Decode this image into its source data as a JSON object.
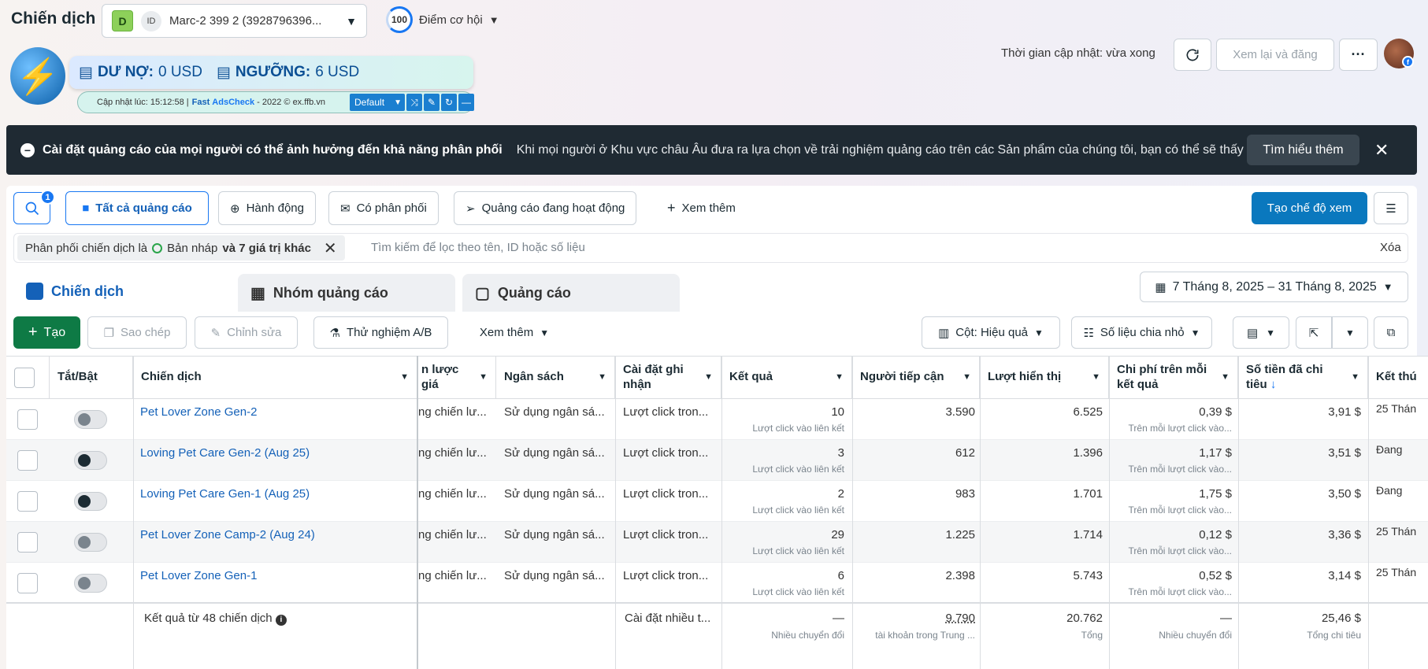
{
  "header": {
    "title": "Chiến dịch",
    "account_badge": "D",
    "account_icon": "ID",
    "account_name": "Marc-2 399 2 (3928796396...",
    "opportunity_score": "100",
    "opportunity_label": "Điểm cơ hội",
    "update_time": "Thời gian cập nhật: vừa xong",
    "review_publish": "Xem lại và đăng",
    "more": "···"
  },
  "adscheck": {
    "debt_label": "DƯ NỢ:",
    "debt_value": "0 USD",
    "threshold_label": "NGƯỠNG:",
    "threshold_value": "6 USD",
    "updated_at": "Cập nhật lúc: 15:12:58 |",
    "fast": "Fast",
    "brand": "AdsCheck",
    "copyright": "- 2022 © ex.ffb.vn",
    "preset": "Default"
  },
  "banner": {
    "title": "Cài đặt quảng cáo của mọi người có thể ảnh hưởng đến khả năng phân phối",
    "body": "Khi mọi người ở Khu vực châu Âu đưa ra lựa chọn về trải nghiệm quảng cáo trên các Sản phẩm của chúng tôi, bạn có thể sẽ thấy tác...",
    "learn_more": "Tìm hiểu thêm"
  },
  "filters": {
    "search_badge": "1",
    "all_ads": "Tất cả quảng cáo",
    "actions": "Hành động",
    "delivering": "Có phân phối",
    "active_ads": "Quảng cáo đang hoạt động",
    "see_more": "Xem thêm",
    "create_view": "Tạo chế độ xem",
    "chip_prefix": "Phân phối chiến dịch là",
    "chip_value": "Bản nháp",
    "chip_more": "và 7 giá trị khác",
    "search_placeholder": "Tìm kiếm để lọc theo tên, ID hoặc số liệu",
    "clear": "Xóa"
  },
  "tabs": {
    "campaigns": "Chiến dịch",
    "adsets": "Nhóm quảng cáo",
    "ads": "Quảng cáo"
  },
  "date_range": "7 Tháng 8, 2025 – 31 Tháng 8, 2025",
  "toolbar": {
    "create": "Tạo",
    "copy": "Sao chép",
    "edit": "Chỉnh sửa",
    "ab_test": "Thử nghiệm A/B",
    "see_more": "Xem thêm",
    "columns": "Cột: Hiệu quả",
    "breakdown": "Số liệu chia nhỏ"
  },
  "table": {
    "headers": {
      "toggle": "Tắt/Bật",
      "campaign": "Chiến dịch",
      "bid_strategy": "n lược giá",
      "budget": "Ngân sách",
      "attribution": "Cài đặt ghi nhận",
      "results": "Kết quả",
      "reach": "Người tiếp cận",
      "impressions": "Lượt hiển thị",
      "cost_per_result": "Chi phí trên mỗi kết quả",
      "amount_spent": "Số tiền đã chi tiêu",
      "ends": "Kết thú"
    },
    "rows": [
      {
        "name": "Pet Lover Zone Gen-2",
        "on": false,
        "bid": "ng chiến lư...",
        "budget": "Sử dụng ngân sá...",
        "attr": "Lượt click tron...",
        "results": "10",
        "results_sub": "Lượt click vào liên kết",
        "reach": "3.590",
        "impr": "6.525",
        "cpr": "0,39 $",
        "cpr_sub": "Trên mỗi lượt click vào...",
        "spent": "3,91 $",
        "ends": "25 Thán"
      },
      {
        "name": "Loving Pet Care Gen-2 (Aug 25)",
        "on": true,
        "bid": "ng chiến lư...",
        "budget": "Sử dụng ngân sá...",
        "attr": "Lượt click tron...",
        "results": "3",
        "results_sub": "Lượt click vào liên kết",
        "reach": "612",
        "impr": "1.396",
        "cpr": "1,17 $",
        "cpr_sub": "Trên mỗi lượt click vào...",
        "spent": "3,51 $",
        "ends": "Đang"
      },
      {
        "name": "Loving Pet Care Gen-1 (Aug 25)",
        "on": true,
        "bid": "ng chiến lư...",
        "budget": "Sử dụng ngân sá...",
        "attr": "Lượt click tron...",
        "results": "2",
        "results_sub": "Lượt click vào liên kết",
        "reach": "983",
        "impr": "1.701",
        "cpr": "1,75 $",
        "cpr_sub": "Trên mỗi lượt click vào...",
        "spent": "3,50 $",
        "ends": "Đang"
      },
      {
        "name": "Pet Lover Zone Camp-2 (Aug 24)",
        "on": false,
        "bid": "ng chiến lư...",
        "budget": "Sử dụng ngân sá...",
        "attr": "Lượt click tron...",
        "results": "29",
        "results_sub": "Lượt click vào liên kết",
        "reach": "1.225",
        "impr": "1.714",
        "cpr": "0,12 $",
        "cpr_sub": "Trên mỗi lượt click vào...",
        "spent": "3,36 $",
        "ends": "25 Thán"
      },
      {
        "name": "Pet Lover Zone Gen-1",
        "on": false,
        "bid": "ng chiến lư...",
        "budget": "Sử dụng ngân sá...",
        "attr": "Lượt click tron...",
        "results": "6",
        "results_sub": "Lượt click vào liên kết",
        "reach": "2.398",
        "impr": "5.743",
        "cpr": "0,52 $",
        "cpr_sub": "Trên mỗi lượt click vào...",
        "spent": "3,14 $",
        "ends": "25 Thán"
      }
    ],
    "summary": {
      "label": "Kết quả từ 48 chiến dịch",
      "attr": "Cài đặt nhiều t...",
      "results": "—",
      "results_sub": "Nhiều chuyển đổi",
      "reach": "9.790",
      "reach_sub": "tài khoản trong Trung ...",
      "impr": "20.762",
      "impr_sub": "Tổng",
      "cpr": "—",
      "cpr_sub": "Nhiều chuyển đổi",
      "spent": "25,46 $",
      "spent_sub": "Tổng chi tiêu"
    }
  },
  "colors": {
    "primary": "#1877f2",
    "create": "#0e7a45",
    "banner": "#1f2a33",
    "view_button": "#0a78be"
  }
}
